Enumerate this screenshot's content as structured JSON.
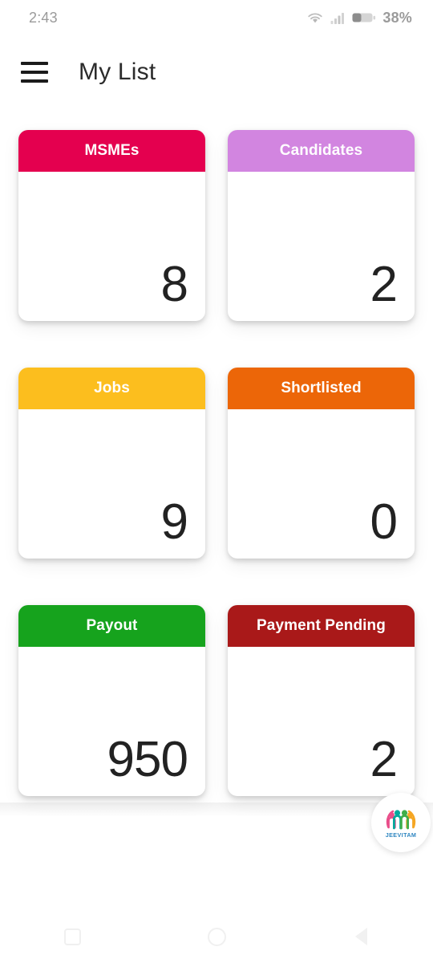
{
  "status_bar": {
    "time": "2:43",
    "battery_percent": "38%",
    "icons": [
      "wifi-icon",
      "cellular-signal-icon",
      "battery-icon"
    ]
  },
  "app_bar": {
    "menu_icon": "hamburger-menu-icon",
    "title": "My List"
  },
  "cards": [
    {
      "label": "MSMEs",
      "value": "8",
      "color": "#E4004F"
    },
    {
      "label": "Candidates",
      "value": "2",
      "color": "#D285E0"
    },
    {
      "label": "Jobs",
      "value": "9",
      "color": "#FCBE1E"
    },
    {
      "label": "Shortlisted",
      "value": "0",
      "color": "#EC6608"
    },
    {
      "label": "Payout",
      "value": "950",
      "color": "#16A31D"
    },
    {
      "label": "Payment Pending",
      "value": "2",
      "color": "#A91919"
    }
  ],
  "brand_badge": {
    "name": "JEEVITAM",
    "icon": "jeevitam-people-logo-icon",
    "colors": {
      "pink": "#E94E8A",
      "teal": "#00A99D",
      "green": "#3FAE49",
      "yellow": "#F5A623",
      "blue": "#2E86C1"
    }
  },
  "navigation_bar": {
    "recents_label": "recents-square-icon",
    "home_label": "home-circle-icon",
    "back_label": "back-triangle-icon"
  }
}
